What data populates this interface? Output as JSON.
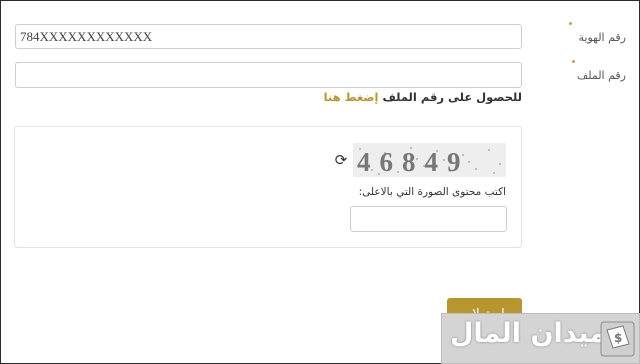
{
  "form": {
    "id_label": "رقم الهوية",
    "id_value": "784XXXXXXXXXXXX",
    "file_label": "رقم الملف",
    "file_value": "",
    "help_text": "للحصول على رقم الملف",
    "help_link": "إضغط هنا"
  },
  "captcha": {
    "code": "46849",
    "label": "اكتب محتوى الصورة التي بالاعلى:",
    "input_value": "",
    "refresh_icon": "refresh-icon"
  },
  "actions": {
    "submit_label": "إستعلام"
  },
  "watermark": {
    "text": "ميدان المال",
    "logo_icon": "money-logo-icon"
  },
  "colors": {
    "accent": "#b8962e",
    "required_dot": "#c9a24a",
    "border": "#cfcfcf"
  }
}
